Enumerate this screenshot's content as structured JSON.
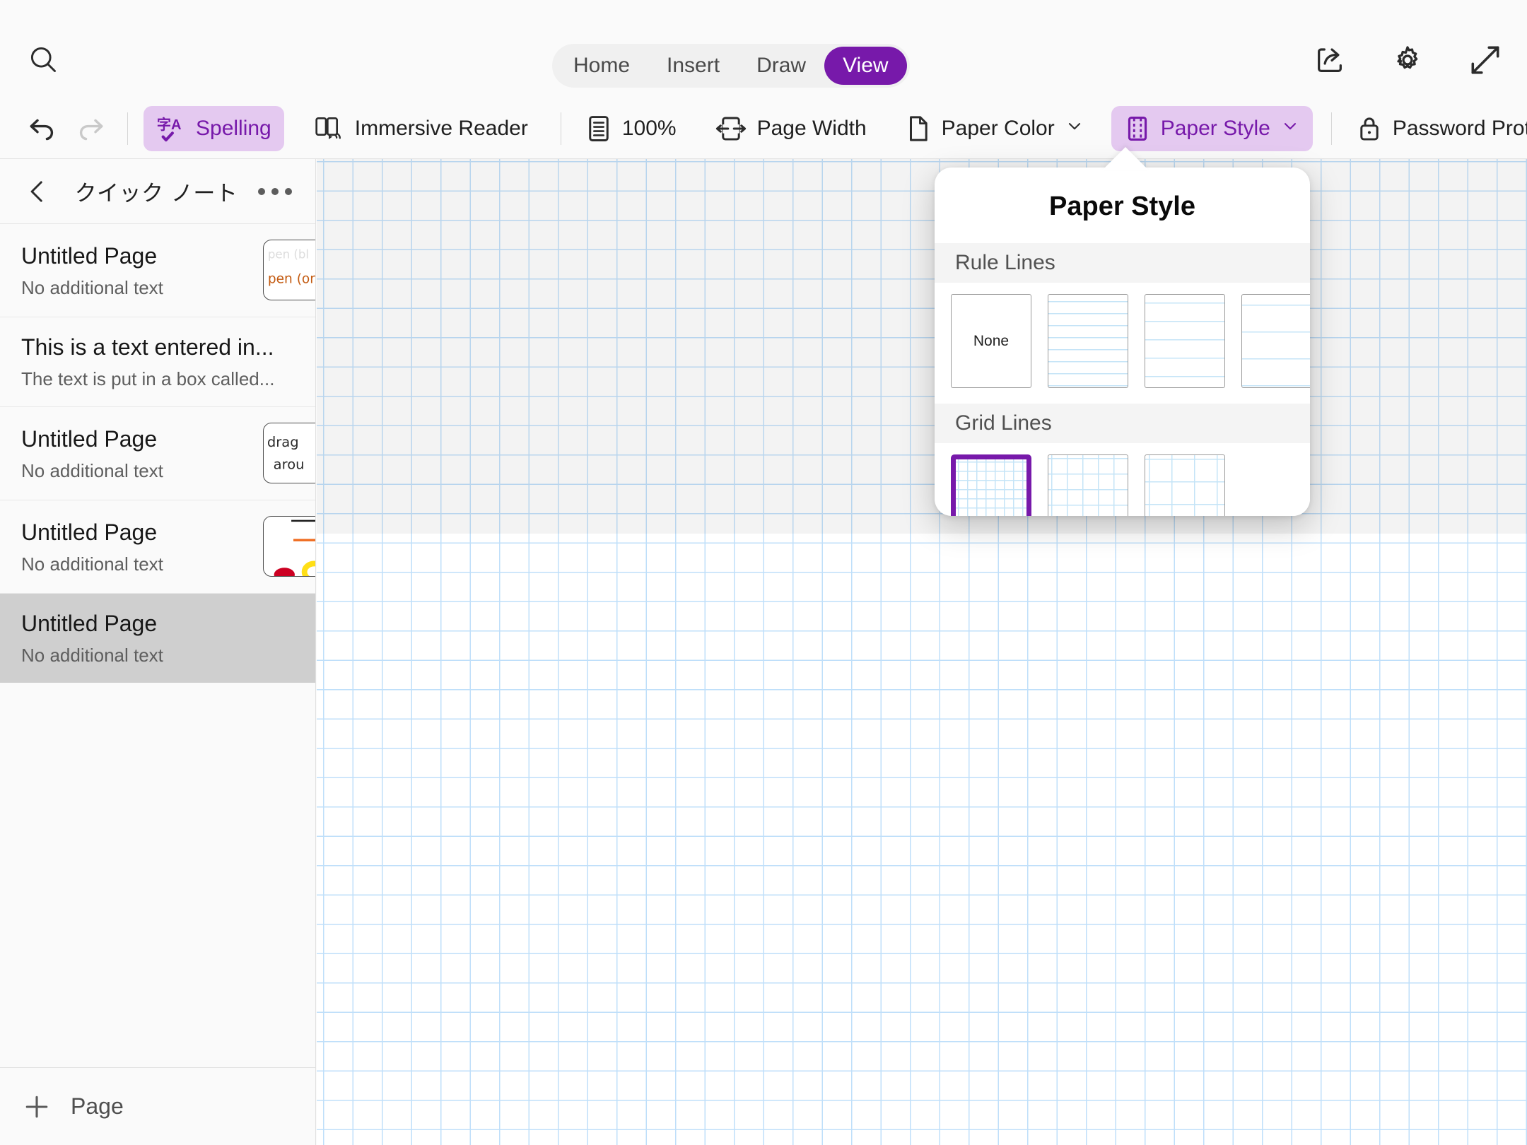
{
  "app": {
    "accent_purple": "#7719AA",
    "accent_purple_light": "#e4c9f0",
    "grid_blue": "#bfdffa"
  },
  "topbar": {
    "search_icon": "search-icon",
    "tabs": [
      {
        "label": "Home",
        "active": false
      },
      {
        "label": "Insert",
        "active": false
      },
      {
        "label": "Draw",
        "active": false
      },
      {
        "label": "View",
        "active": true
      }
    ],
    "right_icons": [
      {
        "name": "share-icon"
      },
      {
        "name": "settings-gear-icon"
      },
      {
        "name": "expand-diagonal-icon"
      }
    ]
  },
  "ribbon": {
    "undo_icon": "undo-icon",
    "redo_icon": "redo-icon",
    "items": [
      {
        "label": "Spelling",
        "icon": "spelling-icon",
        "active": true,
        "chevron": false
      },
      {
        "label": "Immersive Reader",
        "icon": "immersive-reader-icon",
        "active": false,
        "chevron": false
      },
      {
        "label": "100%",
        "icon": "zoom-level-icon",
        "active": false,
        "chevron": false
      },
      {
        "label": "Page Width",
        "icon": "page-width-icon",
        "active": false,
        "chevron": false
      },
      {
        "label": "Paper Color",
        "icon": "paper-color-icon",
        "active": false,
        "chevron": true
      },
      {
        "label": "Paper Style",
        "icon": "paper-style-icon",
        "active": true,
        "chevron": true
      },
      {
        "label": "Password Protection",
        "icon": "lock-icon",
        "active": false,
        "chevron": true
      }
    ],
    "spelling_icon_glyph": "字A"
  },
  "sidebar": {
    "back_icon": "chevron-left-icon",
    "title": "クイック ノート",
    "more_icon": "more-options-icon",
    "pages": [
      {
        "title": "Untitled Page",
        "subtitle": "No additional text",
        "has_thumb": true,
        "thumb": "handwriting-pen-colors",
        "selected": false
      },
      {
        "title": "This is a text entered in...",
        "subtitle": "The text is put in a box called...",
        "has_thumb": false,
        "thumb": "",
        "selected": false
      },
      {
        "title": "Untitled Page",
        "subtitle": "No additional text",
        "has_thumb": true,
        "thumb": "handwriting-drag-around",
        "selected": false
      },
      {
        "title": "Untitled Page",
        "subtitle": "No additional text",
        "has_thumb": true,
        "thumb": "highlighter-strokes",
        "selected": false
      },
      {
        "title": "Untitled Page",
        "subtitle": "No additional text",
        "has_thumb": false,
        "thumb": "",
        "selected": true
      }
    ],
    "footer": {
      "label": "Page",
      "icon": "plus-icon"
    }
  },
  "popover": {
    "title": "Paper Style",
    "sections": [
      {
        "heading": "Rule Lines",
        "options": [
          {
            "name": "none",
            "label": "None",
            "style": "none",
            "selected": false
          },
          {
            "name": "narrow-ruled",
            "label": "",
            "style": "rl-1",
            "selected": false
          },
          {
            "name": "college-ruled",
            "label": "",
            "style": "rl-2",
            "selected": false
          },
          {
            "name": "wide-ruled",
            "label": "",
            "style": "rl-3",
            "selected": false
          }
        ]
      },
      {
        "heading": "Grid Lines",
        "options": [
          {
            "name": "small-grid",
            "label": "",
            "style": "gl-1",
            "selected": true
          },
          {
            "name": "medium-grid",
            "label": "",
            "style": "gl-2",
            "selected": false
          },
          {
            "name": "large-grid",
            "label": "",
            "style": "gl-3",
            "selected": false
          },
          {
            "name": "empty-slot",
            "label": "",
            "style": "blank",
            "selected": false
          }
        ]
      }
    ]
  },
  "canvas": {
    "paper_style": "small-grid",
    "zoom": "100%"
  }
}
